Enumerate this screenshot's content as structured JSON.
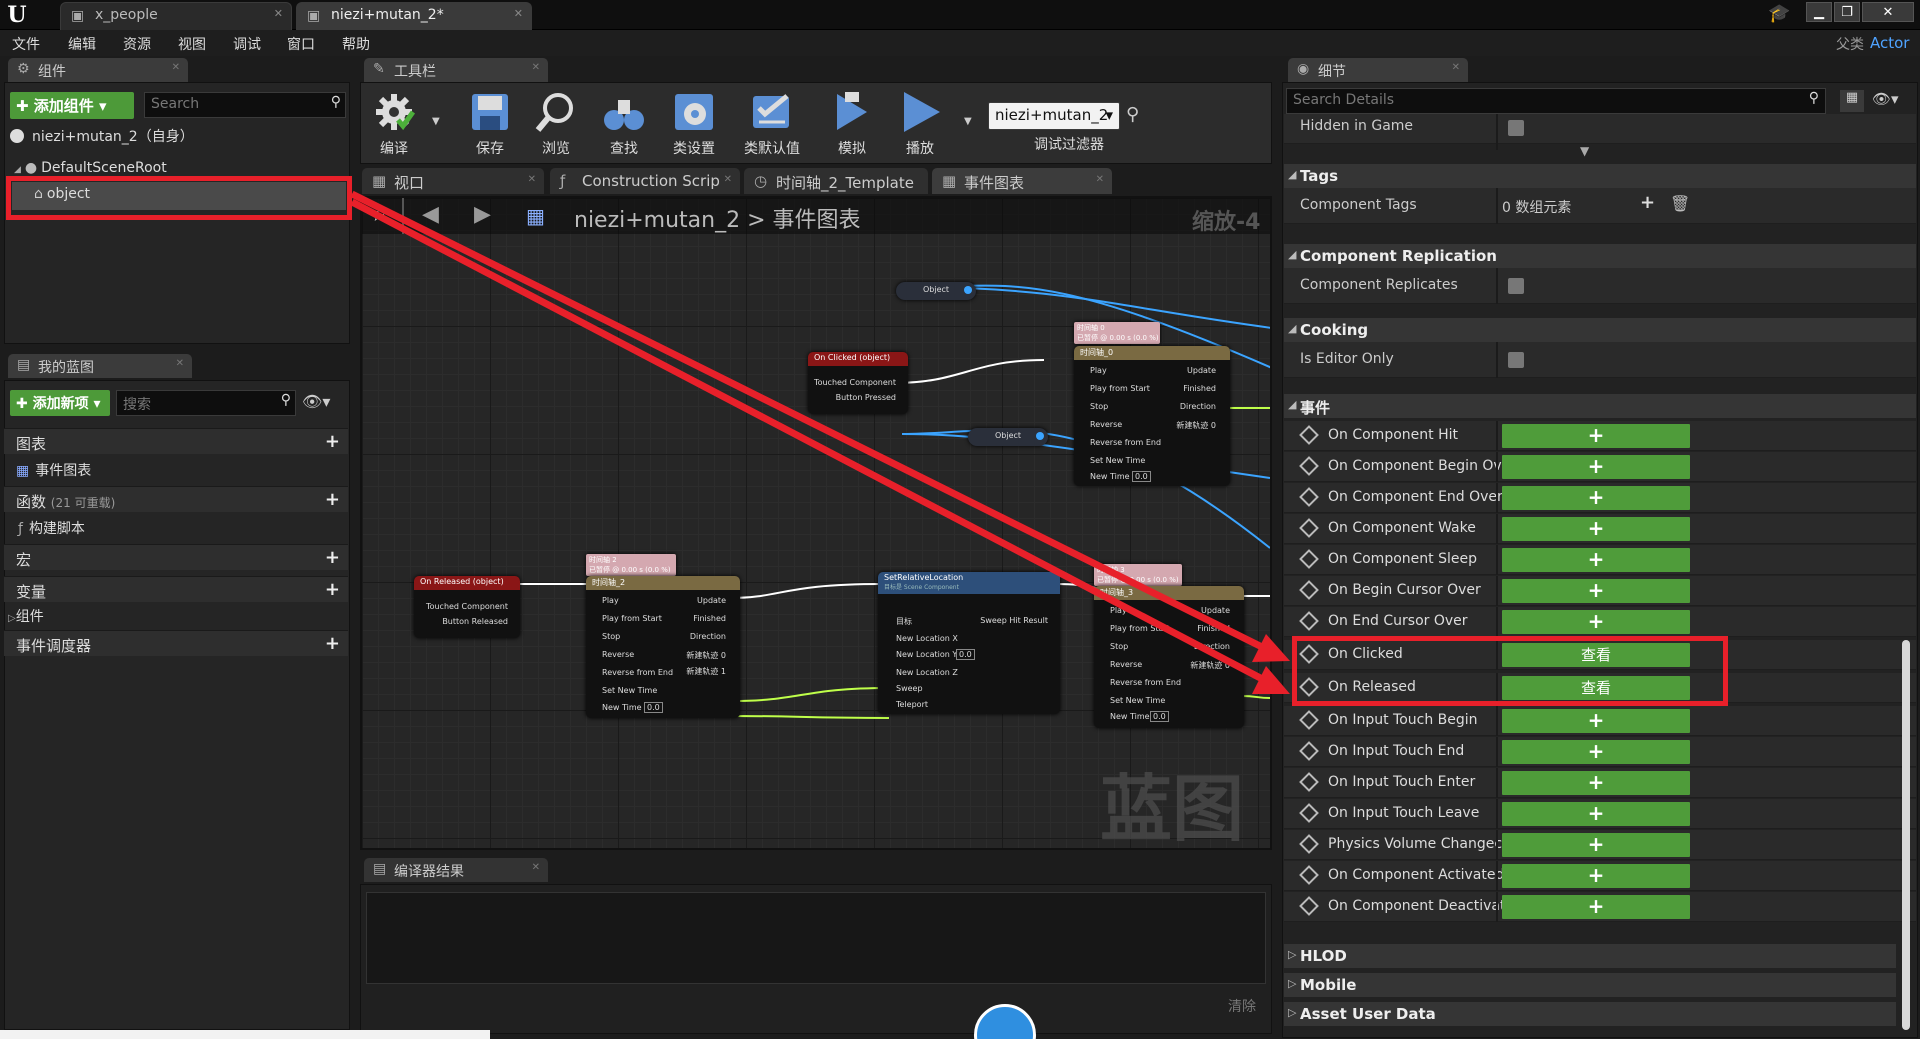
{
  "titlebar": {
    "tab1": "x_people",
    "tab2": "niezi+mutan_2*",
    "parent_label": "父类",
    "parent_value": "Actor"
  },
  "menu": [
    "文件",
    "编辑",
    "资源",
    "视图",
    "调试",
    "窗口",
    "帮助"
  ],
  "components": {
    "tab": "组件",
    "add_button": "添加组件",
    "search_placeholder": "Search",
    "self_item": "niezi+mutan_2（自身）",
    "root_item": "DefaultSceneRoot",
    "object_item": "object"
  },
  "mybp": {
    "tab": "我的蓝图",
    "add_new": "添加新项",
    "search_placeholder": "搜索",
    "rows": {
      "graphs": "图表",
      "event_graph": "事件图表",
      "functions": "函数",
      "functions_count": "(21 可重载)",
      "construct": "构建脚本",
      "macros": "宏",
      "variables": "变量",
      "components": "组件",
      "dispatchers": "事件调度器"
    }
  },
  "toolbar": {
    "tab": "工具栏",
    "buttons": {
      "compile": "编译",
      "save": "保存",
      "browse": "浏览",
      "find": "查找",
      "settings": "类设置",
      "defaults": "类默认值",
      "simulate": "模拟",
      "play": "播放"
    },
    "debug_select": "niezi+mutan_2",
    "debug_filter": "调试过滤器"
  },
  "graph_tabs": {
    "viewport": "视口",
    "construction": "Construction Scrip",
    "timeline": "时间轴_2_Template",
    "event_graph": "事件图表"
  },
  "graph": {
    "breadcrumb_bp": "niezi+mutan_2",
    "breadcrumb_sep": ">",
    "breadcrumb_graph": "事件图表",
    "zoom": "缩放-4",
    "watermark": "蓝图",
    "n_object1": "Object",
    "n_object2": "Object",
    "n_onclicked": {
      "title": "On Clicked (object)",
      "p1": "Touched Component",
      "p2": "Button Pressed"
    },
    "n_onreleased": {
      "title": "On Released (object)",
      "p1": "Touched Component",
      "p2": "Button Released"
    },
    "n_tl0_note": "时间轴 0\n已暂停 @ 0.00 s (0.0 %)",
    "n_tl0": {
      "title": "时间轴_0",
      "play": "Play",
      "pfs": "Play from Start",
      "stop": "Stop",
      "rev": "Reverse",
      "rfe": "Reverse from End",
      "snt": "Set New Time",
      "nt": "New Time",
      "upd": "Update",
      "fin": "Finished",
      "dir": "Direction",
      "track": "新建轨迹 0",
      "ntv": "0.0"
    },
    "n_tl2_note": "时间轴 2\n已暂停 @ 0.00 s (0.0 %)",
    "n_tl2": {
      "title": "时间轴_2",
      "play": "Play",
      "pfs": "Play from Start",
      "stop": "Stop",
      "rev": "Reverse",
      "rfe": "Reverse from End",
      "snt": "Set New Time",
      "nt": "New Time",
      "upd": "Update",
      "fin": "Finished",
      "dir": "Direction",
      "track0": "新建轨迹 0",
      "track1": "新建轨迹 1",
      "ntv": "0.0"
    },
    "n_tl3_note": "时间轴 3\n已暂停 @ 0.00 s (0.0 %)",
    "n_tl3": {
      "title": "时间轴_3",
      "play": "Play",
      "pfs": "Play from Start",
      "stop": "Stop",
      "rev": "Reverse",
      "rfe": "Reverse from End",
      "snt": "Set New Time",
      "nt": "New Time",
      "upd": "Update",
      "fin": "Finished",
      "dir": "Direction",
      "track": "新建轨迹 0",
      "ntv": "0.0"
    },
    "n_setloc": {
      "title": "SetRelativeLocation",
      "sub": "目标是 Scene Component",
      "target": "目标",
      "nlx": "New Location X",
      "nly": "New Location Y",
      "nlz": "New Location Z",
      "sweep": "Sweep",
      "teleport": "Teleport",
      "shr": "Sweep Hit Result",
      "nlyv": "0.0"
    }
  },
  "compiler": {
    "tab": "编译器结果",
    "clear": "清除"
  },
  "details": {
    "tab": "细节",
    "search_placeholder": "Search Details",
    "hidden_in_game": "Hidden in Game",
    "tags_section": "Tags",
    "component_tags": "Component Tags",
    "component_tags_value": "0 数组元素",
    "replication_section": "Component Replication",
    "component_replicates": "Component Replicates",
    "cooking_section": "Cooking",
    "is_editor_only": "Is Editor Only",
    "events_section": "事件",
    "events": [
      {
        "name": "On Component Hit",
        "button": "+"
      },
      {
        "name": "On Component Begin Ove",
        "button": "+"
      },
      {
        "name": "On Component End Overl",
        "button": "+"
      },
      {
        "name": "On Component Wake",
        "button": "+"
      },
      {
        "name": "On Component Sleep",
        "button": "+"
      },
      {
        "name": "On Begin Cursor Over",
        "button": "+"
      },
      {
        "name": "On End Cursor Over",
        "button": "+"
      },
      {
        "name": "On Clicked",
        "button": "查看"
      },
      {
        "name": "On Released",
        "button": "查看"
      },
      {
        "name": "On Input Touch Begin",
        "button": "+"
      },
      {
        "name": "On Input Touch End",
        "button": "+"
      },
      {
        "name": "On Input Touch Enter",
        "button": "+"
      },
      {
        "name": "On Input Touch Leave",
        "button": "+"
      },
      {
        "name": "Physics Volume Changec",
        "button": "+"
      },
      {
        "name": "On Component Activated",
        "button": "+"
      },
      {
        "name": "On Component Deactivat",
        "button": "+"
      }
    ],
    "hlod_section": "HLOD",
    "mobile_section": "Mobile",
    "asset_user_data_section": "Asset User Data"
  },
  "colors": {
    "highlight_red": "#e8202a",
    "green": "#4f9c3a"
  }
}
